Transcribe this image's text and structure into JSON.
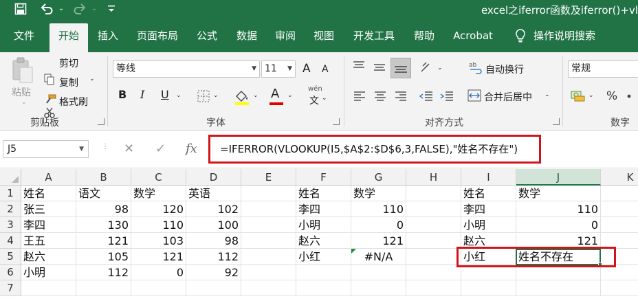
{
  "window": {
    "title": "excel之iferror函数及iferror()+vl"
  },
  "quick_access": {
    "save_icon": "save-icon",
    "undo_icon": "undo-icon",
    "redo_icon": "redo-icon",
    "dropdown_glyph": "⌄"
  },
  "ribbon_tabs": [
    {
      "label": "文件"
    },
    {
      "label": "开始"
    },
    {
      "label": "插入"
    },
    {
      "label": "页面布局"
    },
    {
      "label": "公式"
    },
    {
      "label": "数据"
    },
    {
      "label": "审阅"
    },
    {
      "label": "视图"
    },
    {
      "label": "开发工具"
    },
    {
      "label": "帮助"
    },
    {
      "label": "Acrobat"
    },
    {
      "label": "操作说明搜索"
    }
  ],
  "active_tab": "开始",
  "clipboard": {
    "paste": "粘贴",
    "cut": "剪切",
    "copy": "复制",
    "format_painter": "格式刷",
    "group_label": "剪贴板"
  },
  "font": {
    "font_name": "等线",
    "font_size": "11",
    "grow": "A",
    "shrink": "A",
    "bold": "B",
    "italic": "I",
    "underline": "U",
    "font_color_glyph": "A",
    "phonetic": "文",
    "phonetic_top": "wén",
    "group_label": "字体"
  },
  "alignment": {
    "wrap_text": "自动换行",
    "merge_center": "合并后居中",
    "group_label": "对齐方式"
  },
  "number": {
    "format": "常规",
    "percent": "%",
    "group_label": "数字"
  },
  "formula_bar": {
    "name_box": "J5",
    "cancel": "✕",
    "enter": "✓",
    "fx": "fx",
    "formula": "=IFERROR(VLOOKUP(I5,$A$2:$D$6,3,FALSE),\"姓名不存在\")"
  },
  "grid": {
    "columns": [
      "A",
      "B",
      "C",
      "D",
      "E",
      "F",
      "G",
      "H",
      "I",
      "J",
      "K"
    ],
    "rows": [
      "1",
      "2",
      "3",
      "4",
      "5",
      "6",
      "7"
    ],
    "selected_column": "J",
    "selected_row": "5",
    "cells": {
      "A1": "姓名",
      "B1": "语文",
      "C1": "数学",
      "D1": "英语",
      "A2": "张三",
      "B2": "98",
      "C2": "120",
      "D2": "102",
      "A3": "李四",
      "B3": "130",
      "C3": "110",
      "D3": "100",
      "A4": "王五",
      "B4": "121",
      "C4": "103",
      "D4": "98",
      "A5": "赵六",
      "B5": "105",
      "C5": "121",
      "D5": "112",
      "A6": "小明",
      "B6": "112",
      "C6": "0",
      "D6": "92",
      "F1": "姓名",
      "G1": "数学",
      "F2": "李四",
      "G2": "110",
      "F3": "小明",
      "G3": "0",
      "F4": "赵六",
      "G4": "121",
      "F5": "小红",
      "G5": "#N/A",
      "I1": "姓名",
      "J1": "数学",
      "I2": "李四",
      "J2": "110",
      "I3": "小明",
      "J3": "0",
      "I4": "赵六",
      "J4": "121",
      "I5": "小红",
      "J5": "姓名不存在"
    }
  },
  "colors": {
    "excel_green": "#217346",
    "highlight_red": "#d0141a"
  }
}
